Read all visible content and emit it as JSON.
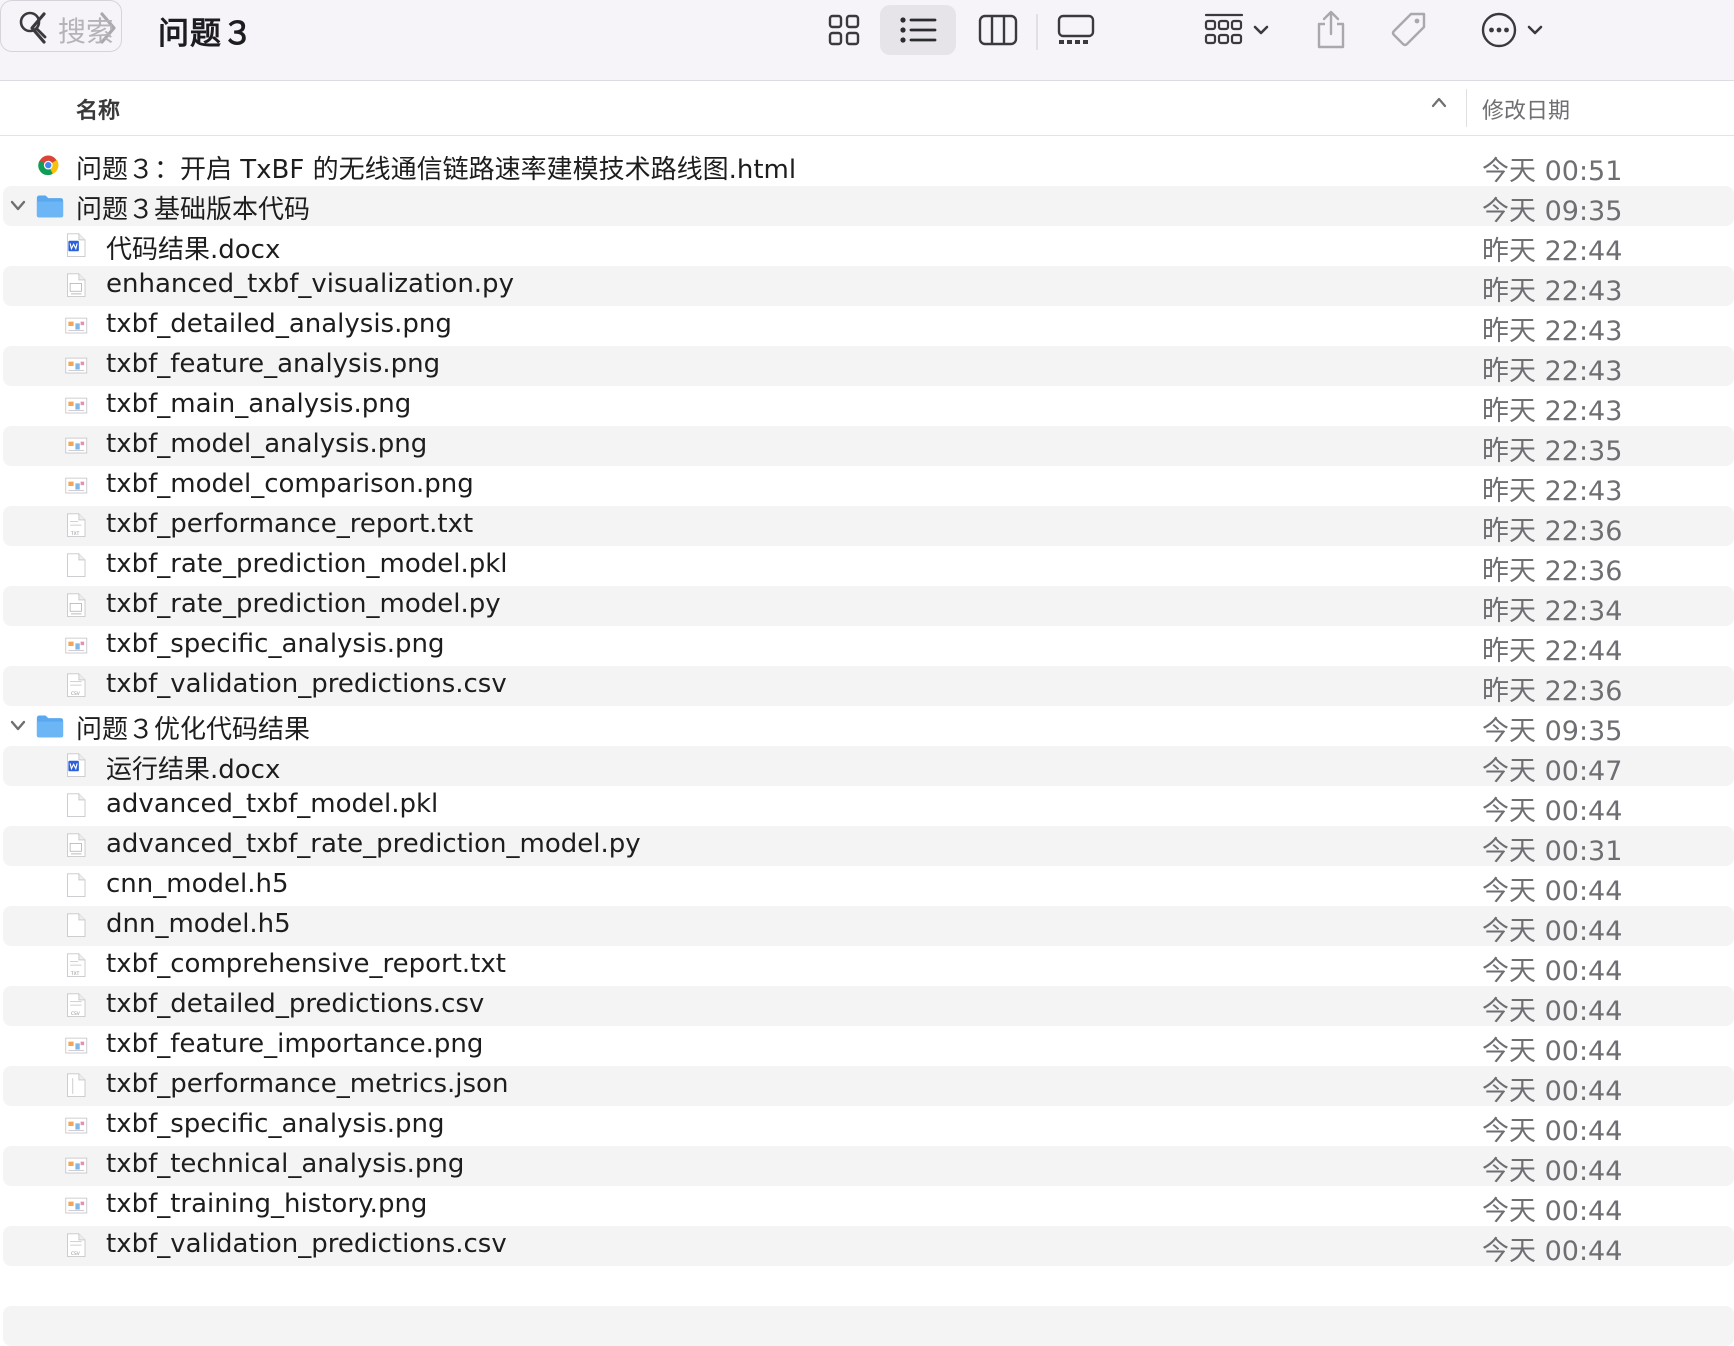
{
  "window": {
    "title": "问题３"
  },
  "search": {
    "placeholder": "搜索"
  },
  "columns": {
    "name": "名称",
    "date": "修改日期"
  },
  "rows": [
    {
      "name": "问题３：开启 TxBF 的无线通信链路速率建模技术路线图.html",
      "date": "今天 00:51",
      "level": 0,
      "kind": "html"
    },
    {
      "name": "问题３基础版本代码",
      "date": "今天 09:35",
      "level": 0,
      "kind": "folder"
    },
    {
      "name": "代码结果.docx",
      "date": "昨天 22:44",
      "level": 1,
      "kind": "docx"
    },
    {
      "name": "enhanced_txbf_visualization.py",
      "date": "昨天 22:43",
      "level": 1,
      "kind": "py"
    },
    {
      "name": "txbf_detailed_analysis.png",
      "date": "昨天 22:43",
      "level": 1,
      "kind": "png"
    },
    {
      "name": "txbf_feature_analysis.png",
      "date": "昨天 22:43",
      "level": 1,
      "kind": "png"
    },
    {
      "name": "txbf_main_analysis.png",
      "date": "昨天 22:43",
      "level": 1,
      "kind": "png"
    },
    {
      "name": "txbf_model_analysis.png",
      "date": "昨天 22:35",
      "level": 1,
      "kind": "png"
    },
    {
      "name": "txbf_model_comparison.png",
      "date": "昨天 22:43",
      "level": 1,
      "kind": "png"
    },
    {
      "name": "txbf_performance_report.txt",
      "date": "昨天 22:36",
      "level": 1,
      "kind": "txt"
    },
    {
      "name": "txbf_rate_prediction_model.pkl",
      "date": "昨天 22:36",
      "level": 1,
      "kind": "blank"
    },
    {
      "name": "txbf_rate_prediction_model.py",
      "date": "昨天 22:34",
      "level": 1,
      "kind": "py"
    },
    {
      "name": "txbf_specific_analysis.png",
      "date": "昨天 22:44",
      "level": 1,
      "kind": "png"
    },
    {
      "name": "txbf_validation_predictions.csv",
      "date": "昨天 22:36",
      "level": 1,
      "kind": "csv"
    },
    {
      "name": "问题３优化代码结果",
      "date": "今天 09:35",
      "level": 0,
      "kind": "folder"
    },
    {
      "name": "运行结果.docx",
      "date": "今天 00:47",
      "level": 1,
      "kind": "docx"
    },
    {
      "name": "advanced_txbf_model.pkl",
      "date": "今天 00:44",
      "level": 1,
      "kind": "blank"
    },
    {
      "name": "advanced_txbf_rate_prediction_model.py",
      "date": "今天 00:31",
      "level": 1,
      "kind": "py"
    },
    {
      "name": "cnn_model.h5",
      "date": "今天 00:44",
      "level": 1,
      "kind": "blank"
    },
    {
      "name": "dnn_model.h5",
      "date": "今天 00:44",
      "level": 1,
      "kind": "blank"
    },
    {
      "name": "txbf_comprehensive_report.txt",
      "date": "今天 00:44",
      "level": 1,
      "kind": "txt"
    },
    {
      "name": "txbf_detailed_predictions.csv",
      "date": "今天 00:44",
      "level": 1,
      "kind": "csv"
    },
    {
      "name": "txbf_feature_importance.png",
      "date": "今天 00:44",
      "level": 1,
      "kind": "png"
    },
    {
      "name": "txbf_performance_metrics.json",
      "date": "今天 00:44",
      "level": 1,
      "kind": "json"
    },
    {
      "name": "txbf_specific_analysis.png",
      "date": "今天 00:44",
      "level": 1,
      "kind": "png"
    },
    {
      "name": "txbf_technical_analysis.png",
      "date": "今天 00:44",
      "level": 1,
      "kind": "png"
    },
    {
      "name": "txbf_training_history.png",
      "date": "今天 00:44",
      "level": 1,
      "kind": "png"
    },
    {
      "name": "txbf_validation_predictions.csv",
      "date": "今天 00:44",
      "level": 1,
      "kind": "csv"
    }
  ],
  "colors": {
    "folder": "#5aa9f0",
    "doc_blue": "#2b5fd9",
    "accent": "#1d1d1f"
  }
}
